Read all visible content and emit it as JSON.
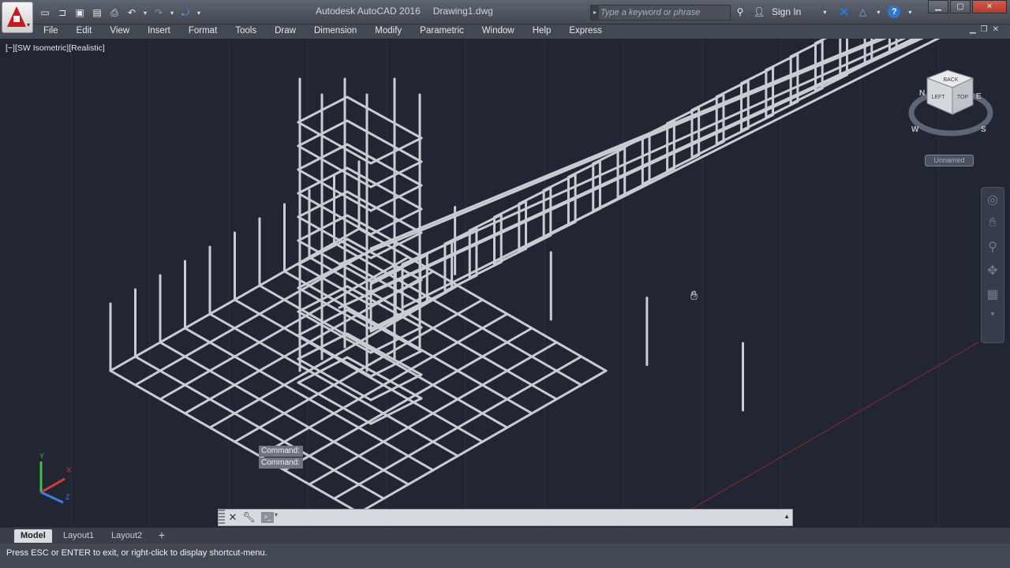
{
  "window": {
    "app_title": "Autodesk AutoCAD 2016",
    "doc_title": "Drawing1.dwg",
    "search_placeholder": "Type a keyword or phrase",
    "sign_in": "Sign In"
  },
  "menu": [
    "File",
    "Edit",
    "View",
    "Insert",
    "Format",
    "Tools",
    "Draw",
    "Dimension",
    "Modify",
    "Parametric",
    "Window",
    "Help",
    "Express"
  ],
  "viewport": {
    "label": "[−][SW Isometric][Realistic]",
    "viewcube_faces": {
      "top": "TOP",
      "left": "LEFT",
      "back": "BACK"
    },
    "compass": {
      "n": "N",
      "e": "E",
      "s": "S",
      "w": "W"
    },
    "ucs_name": "Unnamed",
    "ucs_axes": {
      "x": "X",
      "y": "Y",
      "z": "Z"
    }
  },
  "command": {
    "history": [
      "Command:",
      "Command:"
    ],
    "input_value": ""
  },
  "tabs": [
    {
      "label": "Model",
      "active": true
    },
    {
      "label": "Layout1",
      "active": false
    },
    {
      "label": "Layout2",
      "active": false
    }
  ],
  "status": {
    "message": "Press ESC or ENTER to exit, or right-click to display shortcut-menu."
  },
  "colors": {
    "canvas_bg": "#212632",
    "rebar": "#c9ccd1",
    "ui_dark": "#434953",
    "accent_red": "#c8191e"
  },
  "icons": [
    "autocad-logo-icon",
    "new-icon",
    "open-icon",
    "save-icon",
    "saveas-icon",
    "plot-icon",
    "undo-icon",
    "redo-icon",
    "workspace-icon",
    "binoculars-icon",
    "user-icon",
    "exchange-icon",
    "a360-icon",
    "help-icon",
    "pan-hand-icon",
    "steering-wheel-icon",
    "zoom-icon",
    "orbit-icon",
    "showmotion-icon"
  ]
}
